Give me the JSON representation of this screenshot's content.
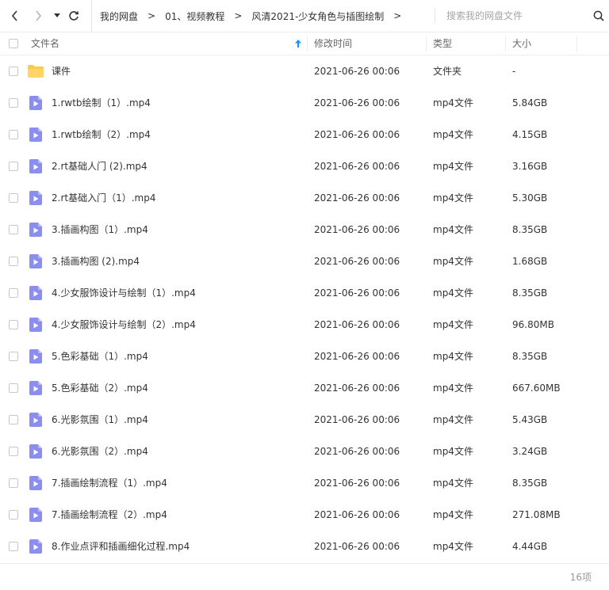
{
  "toolbar": {
    "back_icon": "chevron-left-icon",
    "forward_icon": "chevron-right-icon",
    "history_icon": "caret-down-icon",
    "refresh_icon": "refresh-icon"
  },
  "breadcrumb": {
    "items": [
      "我的网盘",
      "01、视频教程",
      "风清2021-少女角色与插图绘制"
    ],
    "separator": ">"
  },
  "search": {
    "placeholder": "搜索我的网盘文件",
    "icon": "search-icon"
  },
  "table": {
    "columns": {
      "name": "文件名",
      "modified": "修改时间",
      "type": "类型",
      "size": "大小"
    },
    "sort_icon": "sort-up-arrow-icon",
    "rows": [
      {
        "name": "课件",
        "modified": "2021-06-26 00:06",
        "type": "文件夹",
        "size": "-",
        "icon": "folder-icon"
      },
      {
        "name": "1.rwtb绘制（1）.mp4",
        "modified": "2021-06-26 00:06",
        "type": "mp4文件",
        "size": "5.84GB",
        "icon": "video-file-icon"
      },
      {
        "name": "1.rwtb绘制（2）.mp4",
        "modified": "2021-06-26 00:06",
        "type": "mp4文件",
        "size": "4.15GB",
        "icon": "video-file-icon"
      },
      {
        "name": "2.rt基础人门 (2).mp4",
        "modified": "2021-06-26 00:06",
        "type": "mp4文件",
        "size": "3.16GB",
        "icon": "video-file-icon"
      },
      {
        "name": "2.rt基础入门（1）.mp4",
        "modified": "2021-06-26 00:06",
        "type": "mp4文件",
        "size": "5.30GB",
        "icon": "video-file-icon"
      },
      {
        "name": "3.插画构图（1）.mp4",
        "modified": "2021-06-26 00:06",
        "type": "mp4文件",
        "size": "8.35GB",
        "icon": "video-file-icon"
      },
      {
        "name": "3.插画构图 (2).mp4",
        "modified": "2021-06-26 00:06",
        "type": "mp4文件",
        "size": "1.68GB",
        "icon": "video-file-icon"
      },
      {
        "name": "4.少女服饰设计与绘制（1）.mp4",
        "modified": "2021-06-26 00:06",
        "type": "mp4文件",
        "size": "8.35GB",
        "icon": "video-file-icon"
      },
      {
        "name": "4.少女服饰设计与绘制（2）.mp4",
        "modified": "2021-06-26 00:06",
        "type": "mp4文件",
        "size": "96.80MB",
        "icon": "video-file-icon"
      },
      {
        "name": "5.色彩基础（1）.mp4",
        "modified": "2021-06-26 00:06",
        "type": "mp4文件",
        "size": "8.35GB",
        "icon": "video-file-icon"
      },
      {
        "name": "5.色彩基础（2）.mp4",
        "modified": "2021-06-26 00:06",
        "type": "mp4文件",
        "size": "667.60MB",
        "icon": "video-file-icon"
      },
      {
        "name": "6.光影氛围（1）.mp4",
        "modified": "2021-06-26 00:06",
        "type": "mp4文件",
        "size": "5.43GB",
        "icon": "video-file-icon"
      },
      {
        "name": "6.光影氛围（2）.mp4",
        "modified": "2021-06-26 00:06",
        "type": "mp4文件",
        "size": "3.24GB",
        "icon": "video-file-icon"
      },
      {
        "name": "7.插画绘制流程（1）.mp4",
        "modified": "2021-06-26 00:06",
        "type": "mp4文件",
        "size": "8.35GB",
        "icon": "video-file-icon"
      },
      {
        "name": "7.插画绘制流程（2）.mp4",
        "modified": "2021-06-26 00:06",
        "type": "mp4文件",
        "size": "271.08MB",
        "icon": "video-file-icon"
      },
      {
        "name": "8.作业点评和插画细化过程.mp4",
        "modified": "2021-06-26 00:06",
        "type": "mp4文件",
        "size": "4.44GB",
        "icon": "video-file-icon"
      }
    ]
  },
  "footer": {
    "count": "16项"
  },
  "colors": {
    "folder": "#ffc94a",
    "video": "#8b8df0",
    "sort_arrow": "#1890ff",
    "text": "#333333",
    "muted": "#999999"
  }
}
